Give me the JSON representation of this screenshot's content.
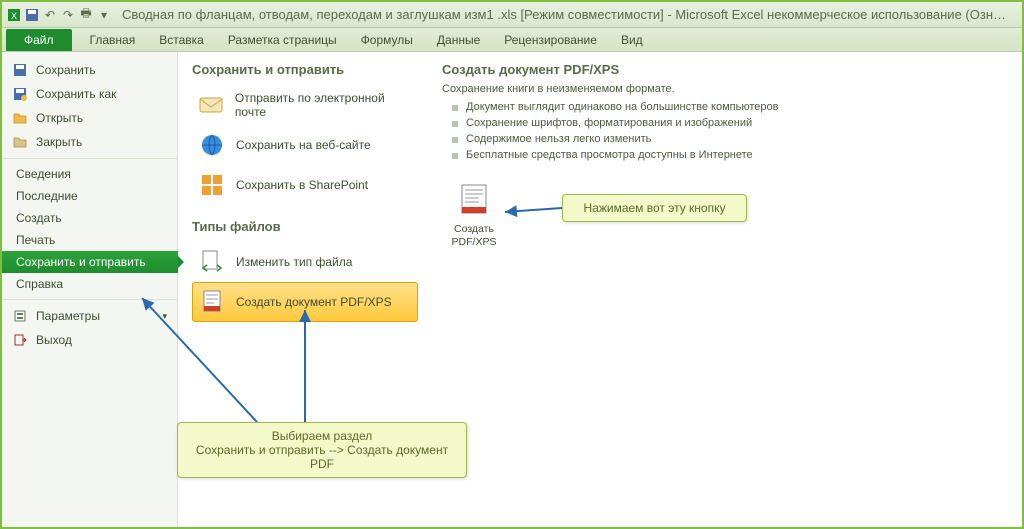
{
  "titlebar": {
    "doc_title": "Сводная по фланцам, отводам, переходам и заглушкам изм1 .xls  [Режим совместимости]  -  Microsoft Excel некоммерческое использование  (Ознакомите..."
  },
  "ribbon": {
    "file": "Файл",
    "tabs": [
      "Главная",
      "Вставка",
      "Разметка страницы",
      "Формулы",
      "Данные",
      "Рецензирование",
      "Вид"
    ]
  },
  "leftnav": {
    "save": "Сохранить",
    "save_as": "Сохранить как",
    "open": "Открыть",
    "close": "Закрыть",
    "info": "Сведения",
    "recent": "Последние",
    "create": "Создать",
    "print": "Печать",
    "save_send": "Сохранить и отправить",
    "help": "Справка",
    "options": "Параметры",
    "exit": "Выход"
  },
  "middle": {
    "heading1": "Сохранить и отправить",
    "email": "Отправить по электронной почте",
    "web": "Сохранить на веб-сайте",
    "sharepoint": "Сохранить в SharePoint",
    "heading2": "Типы файлов",
    "change_type": "Изменить тип файла",
    "create_pdf": "Создать документ PDF/XPS"
  },
  "right": {
    "heading": "Создать документ PDF/XPS",
    "desc": "Сохранение книги в неизменяемом формате.",
    "bullets": [
      "Документ выглядит одинаково на большинстве компьютеров",
      "Сохранение шрифтов, форматирования и изображений",
      "Содержимое нельзя легко изменить",
      "Бесплатные средства просмотра доступны в Интернете"
    ],
    "button_label": "Создать\nPDF/XPS"
  },
  "callouts": {
    "button_hint": "Нажимаем вот эту кнопку",
    "section_hint_line1": "Выбираем раздел",
    "section_hint_line2": "Сохранить и отправить --> Создать документ PDF"
  }
}
